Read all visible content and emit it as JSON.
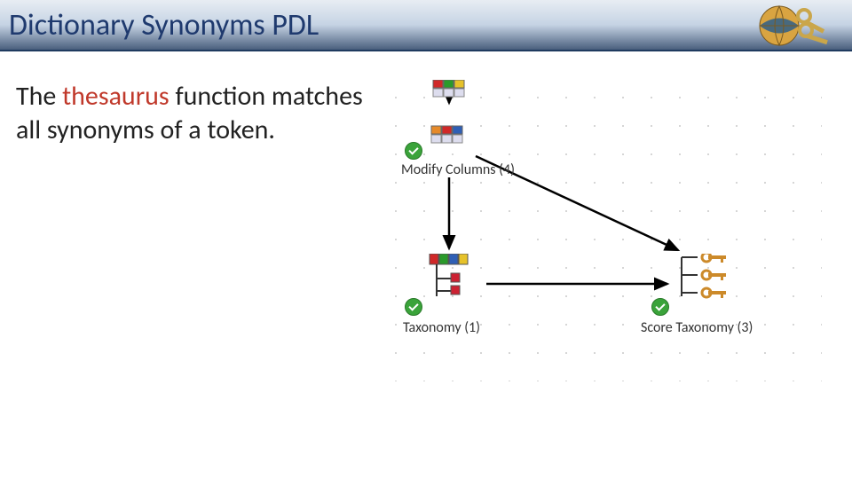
{
  "header": {
    "title": "Dictionary Synonyms PDL"
  },
  "body": {
    "text_pre": "The ",
    "text_highlight": "thesaurus",
    "text_post": " function matches all synonyms of a token."
  },
  "diagram": {
    "nodes": {
      "modify_columns": {
        "label": "Modify Columns (4)"
      },
      "taxonomy": {
        "label": "Taxonomy (1)"
      },
      "score_taxonomy": {
        "label": "Score Taxonomy (3)"
      }
    }
  },
  "colors": {
    "accent": "#1f3a6e",
    "highlight": "#c0392b",
    "check": "#3aa33a"
  }
}
